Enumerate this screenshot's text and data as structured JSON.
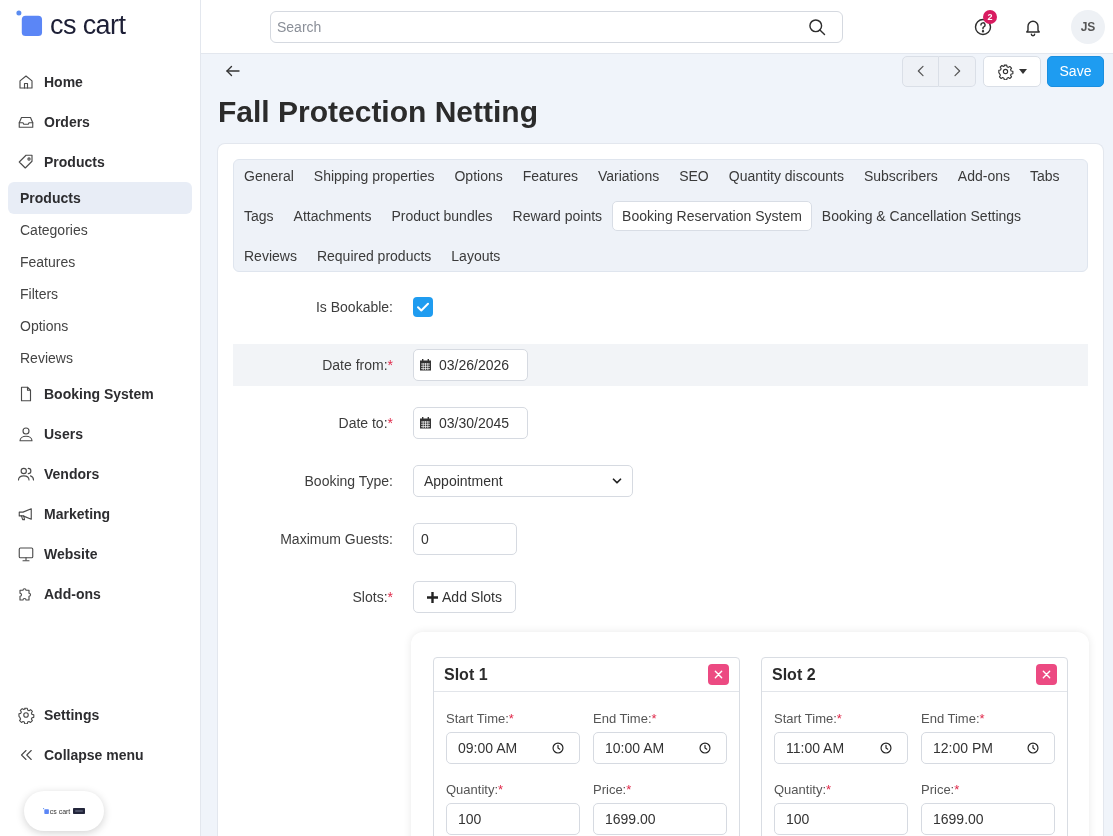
{
  "sidebar": {
    "logo": "cs cart",
    "items": [
      {
        "label": "Home",
        "selected": false
      },
      {
        "label": "Orders",
        "selected": false
      },
      {
        "label": "Products",
        "selected": false,
        "expanded": true,
        "children": [
          {
            "label": "Products",
            "selected": true
          },
          {
            "label": "Categories",
            "selected": false
          },
          {
            "label": "Features",
            "selected": false
          },
          {
            "label": "Filters",
            "selected": false
          },
          {
            "label": "Options",
            "selected": false
          },
          {
            "label": "Reviews",
            "selected": false
          }
        ]
      },
      {
        "label": "Booking System",
        "selected": false
      },
      {
        "label": "Users",
        "selected": false
      },
      {
        "label": "Vendors",
        "selected": false
      },
      {
        "label": "Marketing",
        "selected": false
      },
      {
        "label": "Website",
        "selected": false
      },
      {
        "label": "Add-ons",
        "selected": false
      }
    ],
    "footer_items": [
      {
        "label": "Settings"
      },
      {
        "label": "Collapse menu"
      }
    ],
    "demo_badge": {
      "logo": "cs cart"
    }
  },
  "header": {
    "search": {
      "placeholder": "Search"
    },
    "help_badge": "2",
    "avatar": "JS"
  },
  "toolbar": {
    "save": "Save"
  },
  "page_title": "Fall Protection Netting",
  "tabs": [
    {
      "label": "General",
      "selected": false
    },
    {
      "label": "Shipping properties",
      "selected": false
    },
    {
      "label": "Options",
      "selected": false
    },
    {
      "label": "Features",
      "selected": false
    },
    {
      "label": "Variations",
      "selected": false
    },
    {
      "label": "SEO",
      "selected": false
    },
    {
      "label": "Quantity discounts",
      "selected": false
    },
    {
      "label": "Subscribers",
      "selected": false
    },
    {
      "label": "Add-ons",
      "selected": false
    },
    {
      "label": "Tabs",
      "selected": false
    },
    {
      "label": "Tags",
      "selected": false
    },
    {
      "label": "Attachments",
      "selected": false
    },
    {
      "label": "Product bundles",
      "selected": false
    },
    {
      "label": "Reward points",
      "selected": false
    },
    {
      "label": "Booking Reservation System",
      "selected": true
    },
    {
      "label": "Booking & Cancellation Settings",
      "selected": false
    },
    {
      "label": "Reviews",
      "selected": false
    },
    {
      "label": "Required products",
      "selected": false
    },
    {
      "label": "Layouts",
      "selected": false
    }
  ],
  "form": {
    "fields": [
      {
        "kind": "checkbox",
        "label": "Is Bookable:",
        "checked": true,
        "highlighted": false
      },
      {
        "kind": "date",
        "label": "Date from:",
        "required_mark": "*",
        "value": "03/26/2026",
        "highlighted": true
      },
      {
        "kind": "date",
        "label": "Date to:",
        "required_mark": "*",
        "value": "03/30/2045",
        "highlighted": false
      },
      {
        "kind": "select",
        "label": "Booking Type:",
        "value": "Appointment",
        "highlighted": false
      },
      {
        "kind": "text",
        "label": "Maximum Guests:",
        "value": "0",
        "highlighted": false
      },
      {
        "kind": "button",
        "label": "Slots:",
        "required_mark": "*",
        "button": "Add Slots",
        "highlighted": false
      }
    ]
  },
  "slots": [
    {
      "title": "Slot 1",
      "fields": [
        {
          "kind": "time",
          "label": "Start Time:",
          "required_mark": "*",
          "value": "09:00 AM"
        },
        {
          "kind": "time",
          "label": "End Time:",
          "required_mark": "*",
          "value": "10:00 AM"
        },
        {
          "kind": "text",
          "label": "Quantity:",
          "required_mark": "*",
          "value": "100"
        },
        {
          "kind": "text",
          "label": "Price:",
          "required_mark": "*",
          "value": "1699.00"
        }
      ]
    },
    {
      "title": "Slot 2",
      "fields": [
        {
          "kind": "time",
          "label": "Start Time:",
          "required_mark": "*",
          "value": "11:00 AM"
        },
        {
          "kind": "time",
          "label": "End Time:",
          "required_mark": "*",
          "value": "12:00 PM"
        },
        {
          "kind": "text",
          "label": "Quantity:",
          "required_mark": "*",
          "value": "100"
        },
        {
          "kind": "text",
          "label": "Price:",
          "required_mark": "*",
          "value": "1699.00"
        }
      ]
    }
  ]
}
